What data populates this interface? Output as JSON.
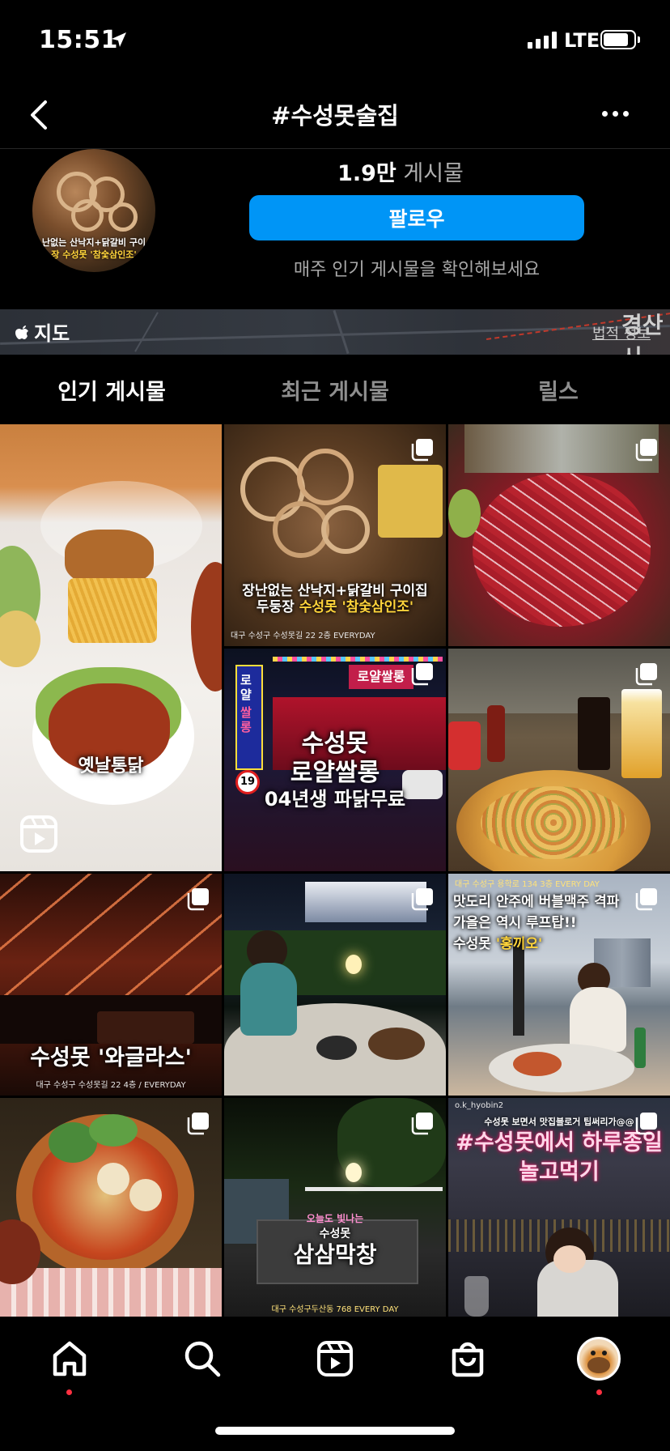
{
  "status_bar": {
    "time": "15:51",
    "network": "LTE"
  },
  "header": {
    "title": "#수성못술집"
  },
  "profile": {
    "avatar_caption_line1": "난없는 산낙지+닭갈비 구이",
    "avatar_caption_line2": "장 수성못 '참숯삼인조'",
    "post_count": "1.9만",
    "post_label": "게시물",
    "follow_label": "팔로우",
    "hint": "매주 인기 게시물을 확인해보세요"
  },
  "map": {
    "label": "지도",
    "city": "경산시",
    "legal": "법적 정보"
  },
  "tabs": [
    {
      "label": "인기 게시물",
      "active": true
    },
    {
      "label": "최근 게시물",
      "active": false
    },
    {
      "label": "릴스",
      "active": false
    }
  ],
  "posts": {
    "p1": {
      "caption": "옛날통닭"
    },
    "p2": {
      "line1": "장난없는 산낙지+닭갈비 구이집",
      "line2a": "두둥장 ",
      "line2b": "수성못 '참숯삼인조'",
      "small": "대구 수성구 수성못길 22 2층 EVERYDAY"
    },
    "p4": {
      "sign1": "로얄",
      "sign2": "쌀롱",
      "sign3": "로얄쌀롱",
      "line1": "수성못",
      "line2": "로얄쌀롱",
      "line3": "04년생 파닭무료",
      "badge": "19"
    },
    "p7": {
      "caption": "수성못 '와글라스'",
      "small": "대구 수성구 수성못길 22 4층 / EVERYDAY"
    },
    "p9": {
      "small": "대구 수성구 용학로 134 3층 EVERY DAY",
      "line1": "맛도리 안주에 버블맥주 격파",
      "line2": "가을은 역시 루프탑!!",
      "line3a": "수성못 ",
      "line3b": "'홍끼오'"
    },
    "p11": {
      "small_top": "오늘도 빛나는",
      "line1": "수성못",
      "line2": "삼삼막창",
      "small": "대구 수성구두산동 768 EVERY DAY"
    },
    "p12": {
      "handle": "o.k_hyobin2",
      "line1": "수성못 보면서 맛집블로거 팁써리가@@",
      "line2": "#수성못에서 하루종일",
      "line3": "놀고먹기"
    }
  },
  "nav": {
    "items": [
      "home-icon",
      "search-icon",
      "reels-icon",
      "shop-icon",
      "profile-avatar"
    ]
  },
  "colors": {
    "accent": "#0095f6",
    "notify": "#ff3040",
    "highlight": "#ffd43b"
  }
}
